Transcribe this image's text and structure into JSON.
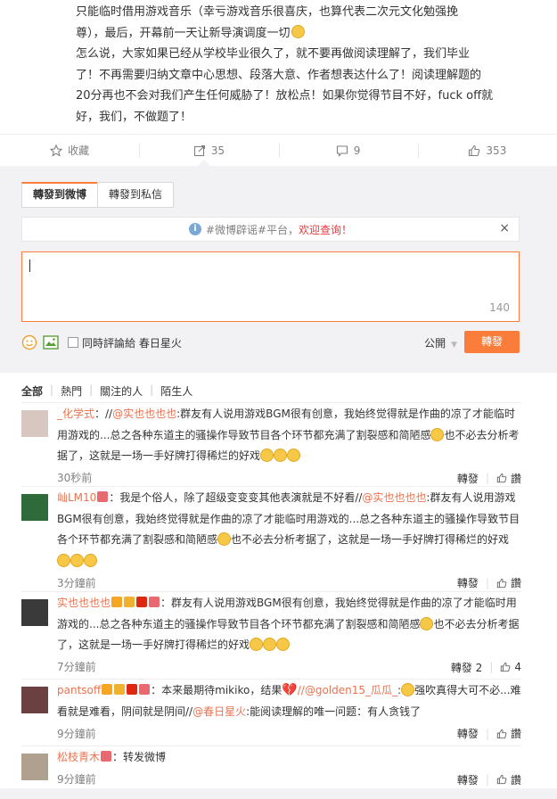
{
  "post": {
    "lines": [
      "只能临时借用游戏音乐（幸亏游戏音乐很喜庆，也算代表二次元文化勉强挽",
      "尊），最后，开幕前一天让新导演调度一切",
      "怎么说，大家如果已经从学校毕业很久了，就不要再做阅读理解了，我们毕业",
      "了！不再需要归纳文章中心思想、段落大意、作者想表达什么了！阅读理解题的",
      "20分再也不会对我们产生任何威胁了！放松点！如果你觉得节目不好，fuck off就",
      "好，我们，不做题了！"
    ]
  },
  "actions": {
    "favorite": "收藏",
    "repost_count": "35",
    "comment_count": "9",
    "like_count": "353"
  },
  "repost": {
    "tab_weibo": "轉發到微博",
    "tab_private": "轉發到私信",
    "notice_prefix": "#微博辟谣#平台，",
    "notice_link": "欢迎查询！",
    "close": "×",
    "char_count": "140",
    "also_comment": "同時評論給 春日星火",
    "visibility": "公開",
    "send": "轉發"
  },
  "filters": [
    "全部",
    "熱門",
    "關注的人",
    "陌生人"
  ],
  "comments": [
    {
      "nick": "_化学式",
      "text_a": "：//",
      "at": "@实也也也也",
      "text_b": ":群友有人说用游戏BGM很有创意，我始终觉得就是作曲的凉了才能临时用游戏的...总之各种东道主的骚操作导致节目各个环节都充满了割裂感和简陋感",
      "text_c": "也不必去分析考据了，这就是一场一手好牌打得稀烂的好戏",
      "time": "30秒前",
      "repost": "轉發",
      "like": "讚",
      "avatar_color": "#d8c7c0"
    },
    {
      "nick": "屾LM10",
      "text_a": "：我是个俗人，除了超级变变变其他表演就是不好看//",
      "at": "@实也也也也",
      "text_b": ":群友有人说用游戏BGM很有创意，我始终觉得就是作曲的凉了才能临时用游戏的...总之各种东道主的骚操作导致节目各个环节都充满了割裂感和简陋感",
      "text_c": "也不必去分析考据了，这就是一场一手好牌打得稀烂的好戏",
      "time": "3分鐘前",
      "repost": "轉發",
      "like": "讚",
      "avatar_color": "#2f6b3a"
    },
    {
      "nick": "实也也也也",
      "text_a": "：群友有人说用游戏BGM很有创意，我始终觉得就是作曲的凉了才能临时用游戏的...总之各种东道主的骚操作导致节目各个环节都充满了割裂感和简陋感",
      "at": "",
      "text_b": "",
      "text_c": "也不必去分析考据了，这就是一场一手好牌打得稀烂的好戏",
      "time": "7分鐘前",
      "repost": "轉發 2",
      "like": "4",
      "avatar_color": "#3a3a3a"
    },
    {
      "nick": "pantsoff",
      "text_a": "：本来最期待mikiko，结果",
      "at": "//@golden15_瓜瓜_",
      "text_b": ":",
      "text_c": "强吹真得大可不必...难看就是难看，阴间就是阴间//",
      "at2": "@春日星火",
      "text_d": ":能阅读理解的唯一问题：有人贪钱了",
      "time": "9分鐘前",
      "repost": "轉發",
      "like": "讚",
      "avatar_color": "#6b4040"
    },
    {
      "nick": "松枝青木",
      "text_a": "：转发微博",
      "at": "",
      "text_b": "",
      "text_c": "",
      "time": "9分鐘前",
      "repost": "轉發",
      "like": "讚",
      "avatar_color": "#b0a090"
    }
  ],
  "colors": {
    "accent": "#fa7d3c",
    "link": "#eb7350",
    "warn": "#e8383d"
  }
}
